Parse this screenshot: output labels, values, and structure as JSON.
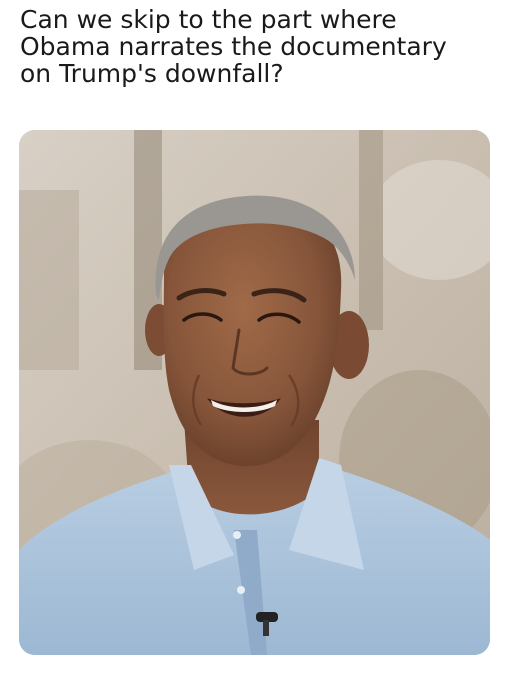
{
  "caption": {
    "lines": [
      "Can we skip to the part where",
      "Obama narrates the documentary",
      "on Trump's downfall?"
    ]
  },
  "photo": {
    "subject": "smiling-man-portrait",
    "background_color": "#cfc7bd",
    "shirt_color": "#a9c3db",
    "skin_color": "#8a5a3e",
    "hair_color": "#9a9792"
  }
}
